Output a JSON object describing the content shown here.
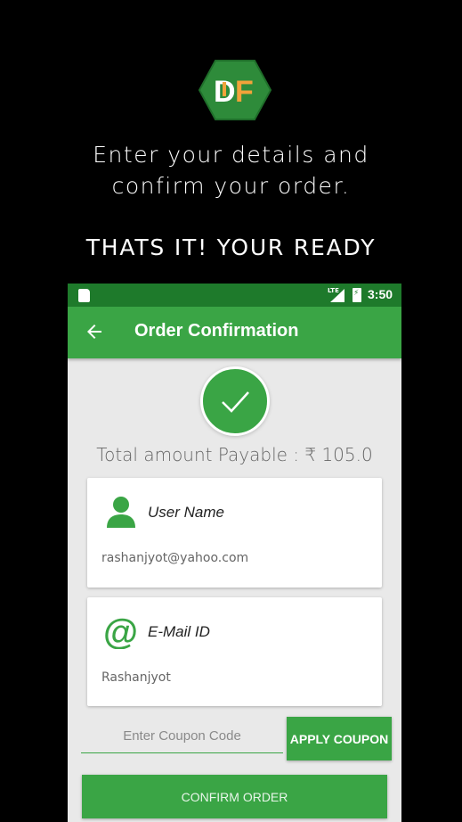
{
  "promo": {
    "logo_text": "DF",
    "headline_line1": "Enter your details and",
    "headline_line2": "confirm your order.",
    "tagline": "THATS IT! YOUR READY"
  },
  "status_bar": {
    "network": "LTE",
    "time": "3:50"
  },
  "app_bar": {
    "title": "Order Confirmation"
  },
  "summary": {
    "total_label": "Total amount Payable : ₹ 105.0"
  },
  "cards": {
    "user": {
      "label": "User Name",
      "value": "rashanjyot@yahoo.com",
      "icon": "person-icon"
    },
    "email": {
      "label": "E-Mail ID",
      "value": "Rashanjyot",
      "icon": "at-sign-icon"
    }
  },
  "coupon": {
    "placeholder": "Enter Coupon Code",
    "value": "",
    "apply_label": "APPLY COUPON"
  },
  "actions": {
    "confirm_label": "CONFIRM ORDER"
  },
  "colors": {
    "primary": "#3aa545",
    "status_bar": "#1e7a2b",
    "logo_bg": "#2e8b3a",
    "logo_accent": "#f2a33a"
  }
}
